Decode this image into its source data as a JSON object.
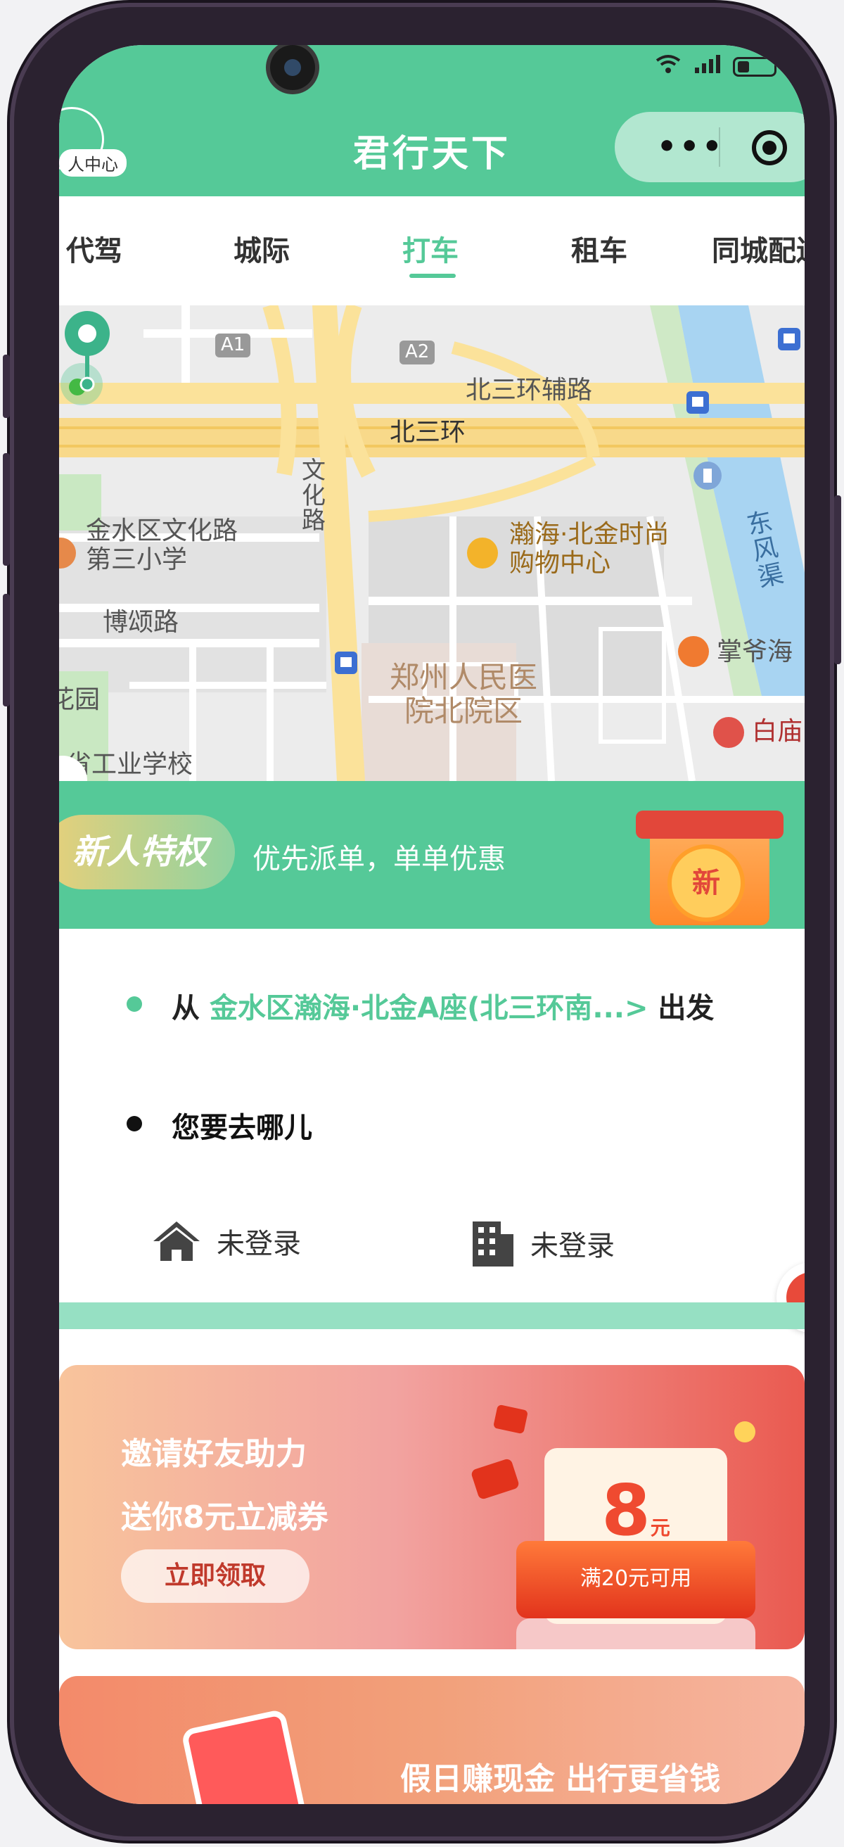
{
  "header": {
    "title": "君行天下",
    "personal_center": "人中心",
    "capsule_more": "•••"
  },
  "tabs": [
    {
      "label": "代驾"
    },
    {
      "label": "城际"
    },
    {
      "label": "打车"
    },
    {
      "label": "租车"
    },
    {
      "label": "同城配送"
    }
  ],
  "active_tab": "打车",
  "map": {
    "labels": {
      "a1": "A1",
      "a2": "A2",
      "road_ring_aux": "北三环辅路",
      "road_ring": "北三环",
      "road_wenhua": "文化路",
      "school": "金水区文化路第三小学",
      "mall": "瀚海·北金时尚购物中心",
      "bosong": "博颂路",
      "hospital": "郑州人民医院北院区",
      "canal": "东风渠",
      "restaurant": "掌爷海",
      "baimiao": "白庙",
      "park": "花园",
      "industrial_school": "省工业学校"
    }
  },
  "promo": {
    "badge": "新人特权",
    "text": "优先派单，单单优惠",
    "gift_label": "新"
  },
  "route": {
    "from_prefix": "从",
    "from_address": "金水区瀚海·北金A座(北三环南...>",
    "from_suffix": "出发",
    "to_placeholder": "您要去哪儿"
  },
  "quick_places": {
    "home_label": "未登录",
    "company_label": "未登录"
  },
  "invite": {
    "line1": "邀请好友助力",
    "line2": "送你8元立减券",
    "button": "立即领取",
    "coupon_amount": "8",
    "coupon_unit": "元",
    "coupon_condition": "满20元可用"
  },
  "bottom_banner": {
    "text": "假日赚现金 出行更省钱"
  },
  "colors": {
    "brand_green": "#55c998",
    "light_green": "#96e0c3",
    "coupon_red": "#ef4a30"
  }
}
